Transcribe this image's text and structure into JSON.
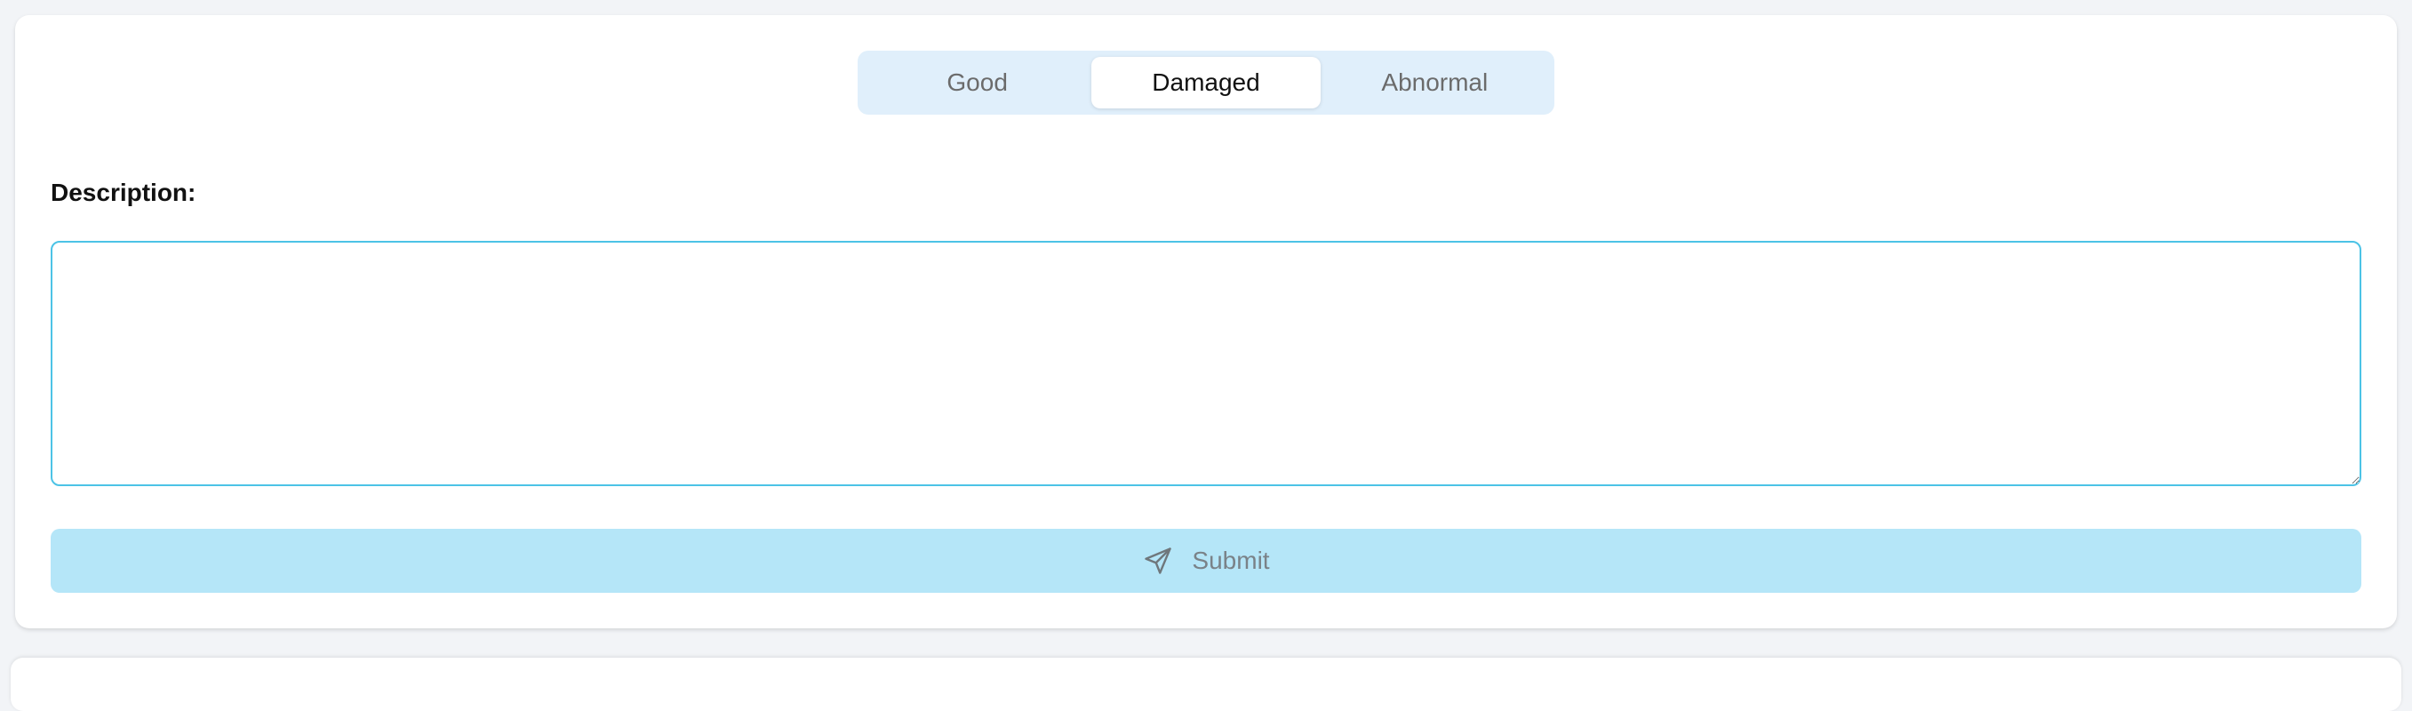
{
  "condition_selector": {
    "options": [
      {
        "label": "Good",
        "selected": false
      },
      {
        "label": "Damaged",
        "selected": true
      },
      {
        "label": "Abnormal",
        "selected": false
      }
    ]
  },
  "description": {
    "label": "Description:",
    "value": "",
    "placeholder": ""
  },
  "submit": {
    "label": "Submit",
    "icon": "send-icon"
  },
  "colors": {
    "accent_border": "#4cc3e6",
    "submit_bg": "#b5e6f8",
    "segment_bg": "#e0effb"
  }
}
